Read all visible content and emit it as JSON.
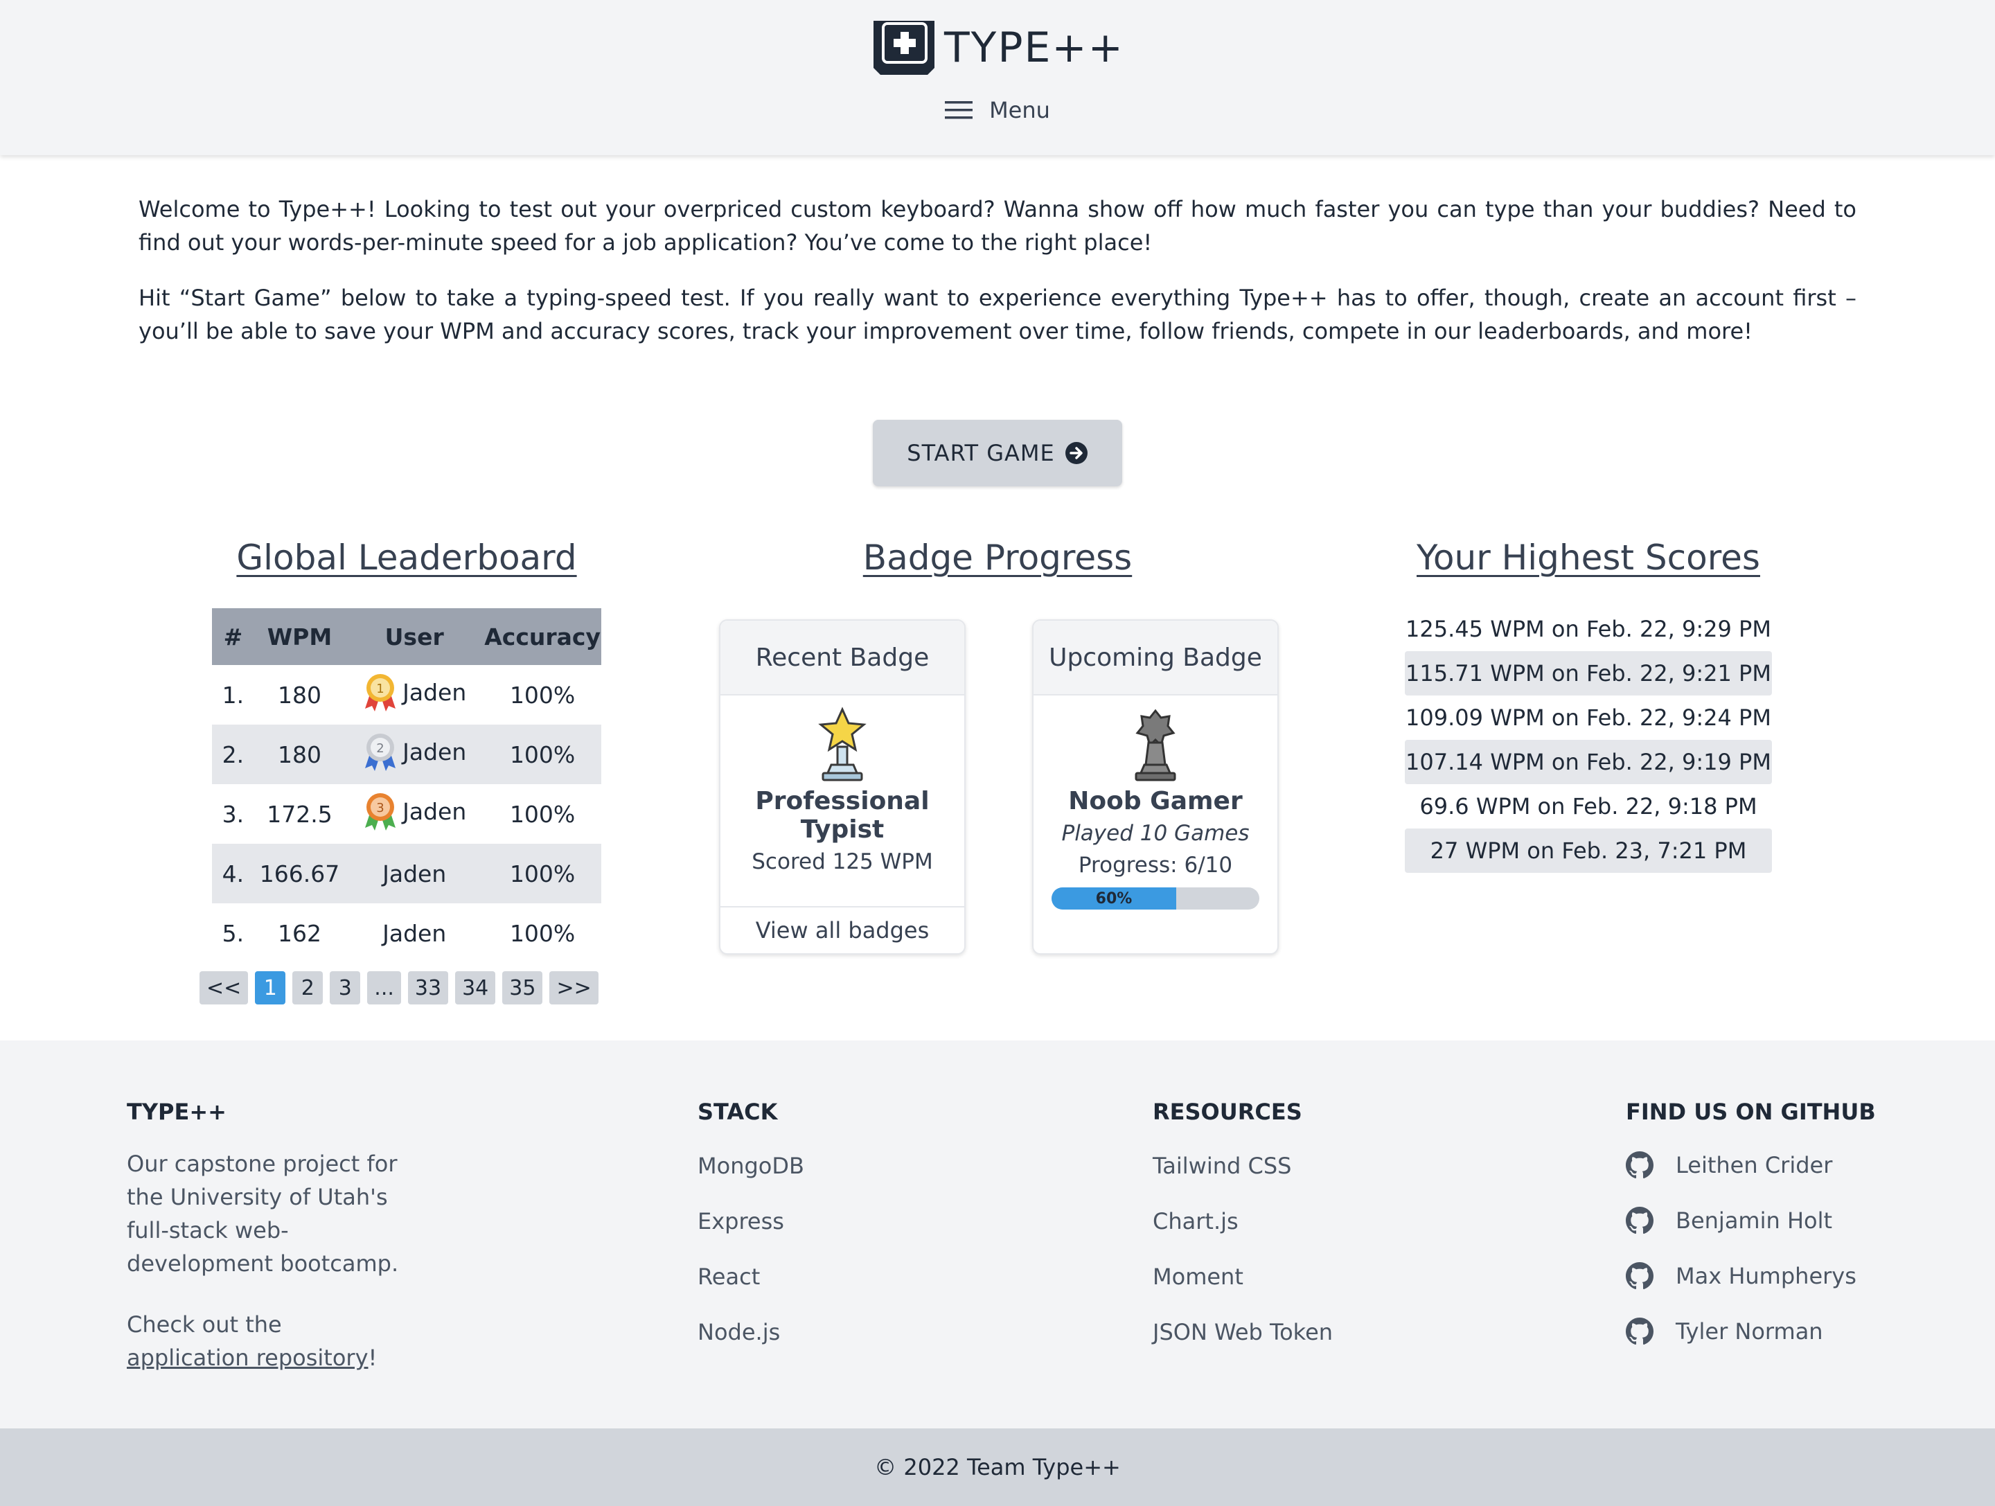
{
  "header": {
    "logo_text": "TYPE++",
    "menu_label": "Menu"
  },
  "intro": {
    "paragraph1": "Welcome to Type++! Looking to test out your overpriced custom keyboard? Wanna show off how much faster you can type than your buddies? Need to find out your words-per-minute speed for a job application? You’ve come to the right place!",
    "paragraph2": "Hit “Start Game” below to take a typing-speed test. If you really want to experience everything Type++ has to offer, though, create an account first – you’ll be able to save your WPM and accuracy scores, track your improvement over time, follow friends, compete in our leaderboards, and more!"
  },
  "start_button": {
    "label": "START GAME",
    "icon": "arrow-circle-right-icon"
  },
  "leaderboard": {
    "title": "Global Leaderboard",
    "columns": [
      "#",
      "WPM",
      "User",
      "Accuracy"
    ],
    "rows": [
      {
        "rank": "1.",
        "wpm": "180",
        "user": "Jaden",
        "accuracy": "100%",
        "medal": "1"
      },
      {
        "rank": "2.",
        "wpm": "180",
        "user": "Jaden",
        "accuracy": "100%",
        "medal": "2"
      },
      {
        "rank": "3.",
        "wpm": "172.5",
        "user": "Jaden",
        "accuracy": "100%",
        "medal": "3"
      },
      {
        "rank": "4.",
        "wpm": "166.67",
        "user": "Jaden",
        "accuracy": "100%"
      },
      {
        "rank": "5.",
        "wpm": "162",
        "user": "Jaden",
        "accuracy": "100%"
      }
    ],
    "pagination": [
      "<<",
      "1",
      "2",
      "3",
      "...",
      "33",
      "34",
      "35",
      ">>"
    ],
    "active_page": "1"
  },
  "badges": {
    "title": "Badge Progress",
    "recent": {
      "header": "Recent Badge",
      "name": "Professional Typist",
      "description": "Scored 125 WPM",
      "footer_link": "View all badges",
      "icon": "trophy-star-icon"
    },
    "upcoming": {
      "header": "Upcoming Badge",
      "name": "Noob Gamer",
      "description": "Played 10 Games",
      "progress_text": "Progress: 6/10",
      "progress_label": "60%",
      "progress_value": 0.6,
      "icon": "pawn-trophy-icon"
    }
  },
  "highest_scores": {
    "title": "Your Highest Scores",
    "items": [
      "125.45 WPM on Feb. 22, 9:29 PM",
      "115.71 WPM on Feb. 22, 9:21 PM",
      "109.09 WPM on Feb. 22, 9:24 PM",
      "107.14 WPM on Feb. 22, 9:19 PM",
      "69.6 WPM on Feb. 22, 9:18 PM",
      "27 WPM on Feb. 23, 7:21 PM"
    ]
  },
  "footer": {
    "about": {
      "heading": "TYPE++",
      "line1": "Our capstone project for",
      "line2": "the University of Utah's",
      "line3": "full-stack web-",
      "line4": "development bootcamp.",
      "check_text": "Check out the",
      "repo_link": "application repository",
      "excl": "!"
    },
    "stack": {
      "heading": "STACK",
      "items": [
        "MongoDB",
        "Express",
        "React",
        "Node.js"
      ]
    },
    "resources": {
      "heading": "RESOURCES",
      "items": [
        "Tailwind CSS",
        "Chart.js",
        "Moment",
        "JSON Web Token"
      ]
    },
    "github": {
      "heading": "FIND US ON GITHUB",
      "people": [
        "Leithen Crider",
        "Benjamin Holt",
        "Max Humpherys",
        "Tyler Norman"
      ]
    },
    "copyright": "© 2022 Team Type++"
  },
  "colors": {
    "header_bg": "#f3f4f6",
    "accent_blue": "#3b9ae1",
    "table_header": "#9ca3af",
    "row_shade": "#e5e7eb",
    "copyright_bg": "#d1d5db"
  }
}
